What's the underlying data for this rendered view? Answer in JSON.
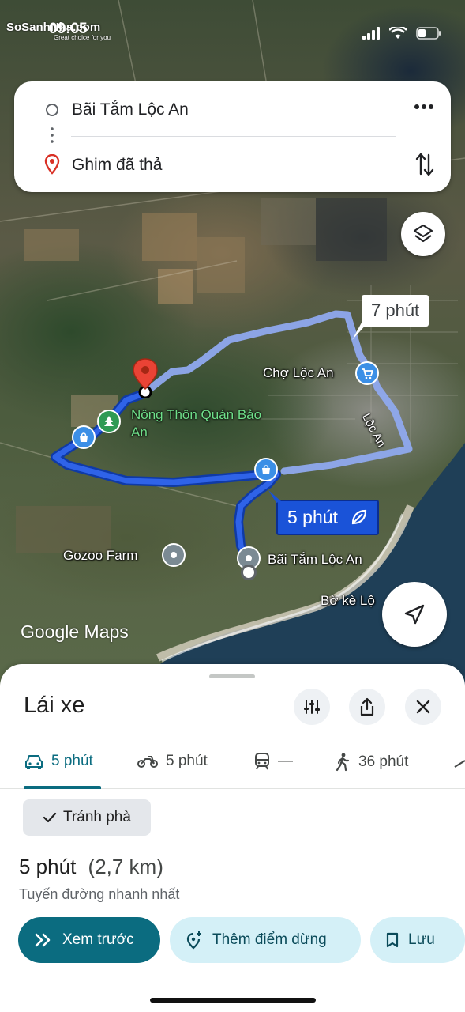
{
  "status_bar": {
    "time": "09:05"
  },
  "watermark": {
    "brand": "SoSanhNha.com",
    "tagline": "Great choice for you"
  },
  "search": {
    "origin": "Bãi Tắm Lộc An",
    "destination": "Ghim đã thả",
    "icons": [
      "more-vert-icon",
      "swap-icon",
      "layers-icon"
    ]
  },
  "map": {
    "labels": {
      "market": "Chợ Lộc An",
      "road": "Lộc An",
      "restaurant": "Nông Thôn Quán Bảo An",
      "farm": "Gozoo Farm",
      "beach": "Bãi Tắm Lộc An",
      "embankment": "Bờ kè Lộ"
    },
    "route_alt_time": "7 phút",
    "route_main_time": "5 phút",
    "attribution": "Google Maps",
    "colors": {
      "route_main": "#1a53d8",
      "route_alt": "#8fa9ee"
    }
  },
  "sheet": {
    "title": "Lái xe",
    "modes": [
      {
        "label": "5 phút",
        "icon": "car-icon"
      },
      {
        "label": "5 phút",
        "icon": "motorbike-icon"
      },
      {
        "label": "—",
        "icon": "transit-icon"
      },
      {
        "label": "36 phút",
        "icon": "walk-icon"
      }
    ],
    "chip": "Tránh phà",
    "summary": {
      "time": "5 phút",
      "distance": "(2,7 km)"
    },
    "subtitle": "Tuyến đường nhanh nhất",
    "actions": {
      "preview": "Xem trước",
      "add_stop": "Thêm điểm dừng",
      "save": "Lưu"
    },
    "accent": "#0b6c80"
  }
}
